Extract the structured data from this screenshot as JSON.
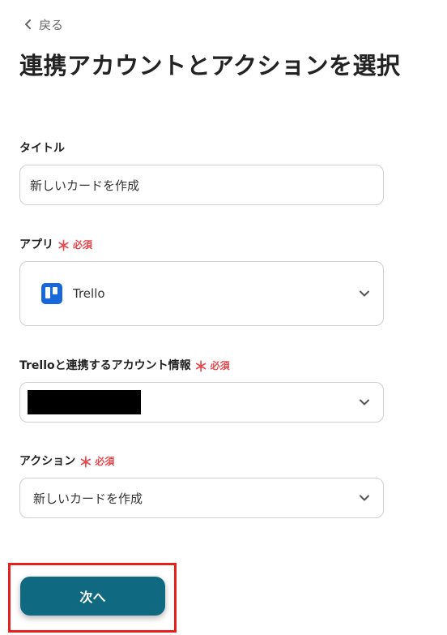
{
  "nav": {
    "back_label": "戻る"
  },
  "page": {
    "title": "連携アカウントとアクションを選択"
  },
  "required_label": "必須",
  "required_mark": "＊",
  "fields": {
    "title": {
      "label": "タイトル",
      "value": "新しいカードを作成"
    },
    "app": {
      "label": "アプリ",
      "value": "Trello",
      "icon": "trello-logo-icon"
    },
    "account": {
      "label": "Trelloと連携するアカウント情報",
      "value_redacted": true
    },
    "action": {
      "label": "アクション",
      "value": "新しいカードを作成"
    }
  },
  "next_button": {
    "label": "次へ"
  },
  "colors": {
    "primary": "#0f6a81",
    "required": "#e5484d",
    "highlight": "#e5201e",
    "trello": "#1868db"
  }
}
